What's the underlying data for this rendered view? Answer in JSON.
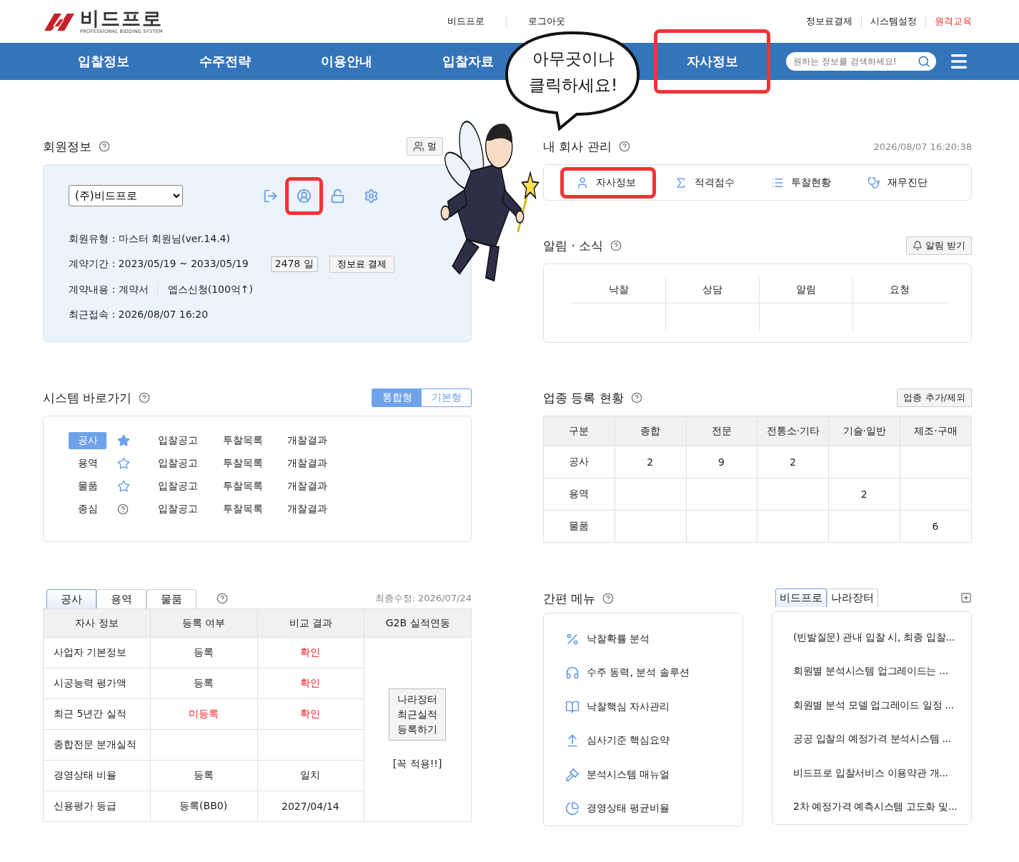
{
  "header": {
    "logo": {
      "name": "비드프로",
      "tagline": "PROFESSIONAL BIDDING SYSTEM"
    },
    "center_links": [
      "비드프로",
      "로그아웃"
    ],
    "util_links": [
      {
        "label": "정보료결제",
        "highlight": false
      },
      {
        "label": "시스템설정",
        "highlight": false
      },
      {
        "label": "원격교육",
        "highlight": true
      }
    ]
  },
  "nav": {
    "items": [
      {
        "label": "입찰정보",
        "highlighted": false
      },
      {
        "label": "수주전략",
        "highlighted": false
      },
      {
        "label": "이용안내",
        "highlighted": false
      },
      {
        "label": "입찰자료",
        "highlighted": false
      },
      {
        "label": "자사정보",
        "highlighted": true
      }
    ],
    "search": {
      "placeholder": "원하는 정보를 검색하세요!"
    }
  },
  "callout": {
    "lines": [
      "아무곳이나",
      "클릭하세요!"
    ]
  },
  "member": {
    "title": "회원정보",
    "button": "멀",
    "company": "(주)비드프로",
    "actions": [
      {
        "kind": "exit",
        "highlighted": false
      },
      {
        "kind": "profile",
        "highlighted": true
      },
      {
        "kind": "unlock",
        "highlighted": false
      },
      {
        "kind": "settings",
        "highlighted": false
      }
    ],
    "type_line": "회원유형 : 마스터 회원님(ver.14.4)",
    "period_line": "계약기간 : 2023/05/19 ~ 2033/05/19",
    "days": "2478 일",
    "pay_button": "정보료 결제",
    "contract_line": "계약내용 : 계약서",
    "contract_extra": "엡스신청(100억↑)",
    "last_login": "최근접속 :  2026/08/07 16:20"
  },
  "company": {
    "title": "내 회사 관리",
    "datetime": "2026/08/07 16:20:38",
    "tabs": [
      {
        "label": "자사정보",
        "kind": "user",
        "highlighted": true
      },
      {
        "label": "적격점수",
        "kind": "sigma",
        "highlighted": false
      },
      {
        "label": "투찰현황",
        "kind": "list",
        "highlighted": false
      },
      {
        "label": "재무진단",
        "kind": "stethoscope",
        "highlighted": false
      }
    ]
  },
  "news": {
    "title": "알림 · 소식",
    "button": "알림 받기",
    "columns": [
      "낙찰",
      "상담",
      "알림",
      "요청"
    ]
  },
  "shortcuts": {
    "title": "시스템 바로가기",
    "modes": [
      {
        "label": "통합형",
        "selected": true
      },
      {
        "label": "기본형",
        "selected": false
      }
    ],
    "rows": [
      {
        "category": "공사",
        "selected": true,
        "kind": "starred",
        "links": [
          "입찰공고",
          "투찰목록",
          "개찰결과"
        ]
      },
      {
        "category": "용역",
        "selected": false,
        "kind": "unstarred",
        "links": [
          "입찰공고",
          "투찰목록",
          "개찰결과"
        ]
      },
      {
        "category": "물품",
        "selected": false,
        "kind": "unstarred",
        "links": [
          "입찰공고",
          "투찰목록",
          "개찰결과"
        ]
      },
      {
        "category": "종심",
        "selected": false,
        "kind": "help",
        "links": [
          "입찰공고",
          "투찰목록",
          "개찰결과"
        ]
      }
    ]
  },
  "industry": {
    "title": "업종 등록 현황",
    "button": "업종 추가/제외",
    "columns": [
      "구분",
      "종합",
      "전문",
      "전통소·기타",
      "기술·일반",
      "제조·구매"
    ],
    "rows": [
      [
        "공사",
        "2",
        "9",
        "2",
        "",
        ""
      ],
      [
        "용역",
        "",
        "",
        "",
        "2",
        ""
      ],
      [
        "물품",
        "",
        "",
        "",
        "",
        "6"
      ]
    ]
  },
  "company_table": {
    "tabs": [
      {
        "label": "공사",
        "selected": true
      },
      {
        "label": "용역",
        "selected": false
      },
      {
        "label": "물품",
        "selected": false
      }
    ],
    "updated": "최종수정: 2026/07/24",
    "columns": [
      "자사 정보",
      "등록 여부",
      "비교 결과",
      "G2B 실적연동"
    ],
    "rows": [
      [
        {
          "text": "사업자 기본정보",
          "alert": false
        },
        {
          "text": "등록",
          "alert": false
        },
        {
          "text": "확인",
          "alert": true
        }
      ],
      [
        {
          "text": "시공능력 평가액",
          "alert": false
        },
        {
          "text": "등록",
          "alert": false
        },
        {
          "text": "확인",
          "alert": true
        }
      ],
      [
        {
          "text": "최근 5년간 실적",
          "alert": false
        },
        {
          "text": "미등록",
          "alert": true
        },
        {
          "text": "확인",
          "alert": true
        }
      ],
      [
        {
          "text": "종합전문 분개실적",
          "alert": false
        },
        {
          "text": ""
        },
        {
          "text": ""
        }
      ],
      [
        {
          "text": "경영상태 비율",
          "alert": false
        },
        {
          "text": "등록",
          "alert": false
        },
        {
          "text": "일치",
          "alert": false
        }
      ],
      [
        {
          "text": "신용평가 등급",
          "alert": false
        },
        {
          "text": "등록(BB0)",
          "alert": false
        },
        {
          "text": "2027/04/14",
          "alert": false
        }
      ]
    ],
    "g2b": {
      "button_lines": [
        "나라장터",
        "최근실적",
        "등록하기"
      ],
      "note": "[꼭 적용!!]"
    }
  },
  "quick_menu": {
    "title": "간편 메뉴",
    "items": [
      {
        "label": "낙찰확률 분석",
        "kind": "percent"
      },
      {
        "label": "수주 동력, 분석 솔루션",
        "kind": "headset"
      },
      {
        "label": "낙찰핵심 자사관리",
        "kind": "book"
      },
      {
        "label": "심사기준 핵심요약",
        "kind": "upload"
      },
      {
        "label": "분석시스템 매뉴얼",
        "kind": "hammer"
      },
      {
        "label": "경영상태 평균비율",
        "kind": "pie"
      }
    ]
  },
  "notices": {
    "tabs": [
      {
        "label": "비드프로",
        "selected": true
      },
      {
        "label": "나라장터",
        "selected": false
      }
    ],
    "items": [
      "(빈발질문) 관내 입찰 시, 최종 입찰...",
      "회원별 분석시스템 업그레이드는 ...",
      "회원별 분석 모델 업그레이드 일정 ...",
      "공공 입찰의 예정가격 분석시스템 ...",
      "비드프로 입찰서비스 이용약관 개...",
      "2차 예정가격 예측시스템 고도화 및..."
    ]
  }
}
